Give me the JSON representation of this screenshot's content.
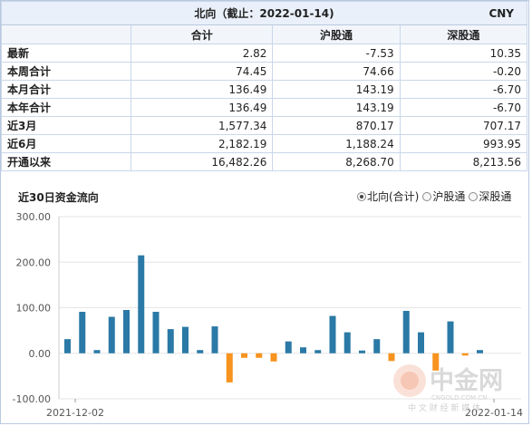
{
  "table": {
    "title": "北向（截止：2022-01-14)",
    "currency": "CNY",
    "columns": [
      "合计",
      "沪股通",
      "深股通"
    ],
    "rows": [
      {
        "label": "最新",
        "values": [
          "2.82",
          "-7.53",
          "10.35"
        ]
      },
      {
        "label": "本周合计",
        "values": [
          "74.45",
          "74.66",
          "-0.20"
        ]
      },
      {
        "label": "本月合计",
        "values": [
          "136.49",
          "143.19",
          "-6.70"
        ]
      },
      {
        "label": "本年合计",
        "values": [
          "136.49",
          "143.19",
          "-6.70"
        ]
      },
      {
        "label": "近3月",
        "values": [
          "1,577.34",
          "870.17",
          "707.17"
        ]
      },
      {
        "label": "近6月",
        "values": [
          "2,182.19",
          "1,188.24",
          "993.95"
        ]
      },
      {
        "label": "开通以来",
        "values": [
          "16,482.26",
          "8,268.70",
          "8,213.56"
        ]
      }
    ]
  },
  "chart_section": {
    "title": "近30日资金流向",
    "legend_options": [
      {
        "label": "北向(合计)",
        "selected": true
      },
      {
        "label": "沪股通",
        "selected": false
      },
      {
        "label": "深股通",
        "selected": false
      }
    ]
  },
  "watermark": {
    "brand": "中金网",
    "domain": "CNGOLD.COM.CN",
    "slogan": "中 文 财 经 新 媒 体"
  },
  "chart_data": {
    "type": "bar",
    "title": "近30日资金流向",
    "ylim": [
      -100,
      300
    ],
    "yticks": [
      "300.00",
      "200.00",
      "100.00",
      "0.00",
      "-100.00"
    ],
    "x_start_label": "2021-12-02",
    "x_end_label": "2022-01-14",
    "grid": true,
    "legend_position": "top-right",
    "colors": {
      "positive": "#2a79a6",
      "negative": "#f7931e",
      "grid": "#e6e6e6"
    },
    "values": [
      31,
      91,
      7,
      80,
      95,
      215,
      91,
      53,
      58,
      7,
      59,
      -64,
      -10,
      -10,
      -18,
      26,
      13,
      7,
      82,
      46,
      6,
      31,
      -17,
      93,
      46,
      -38,
      70,
      -5,
      7
    ]
  }
}
